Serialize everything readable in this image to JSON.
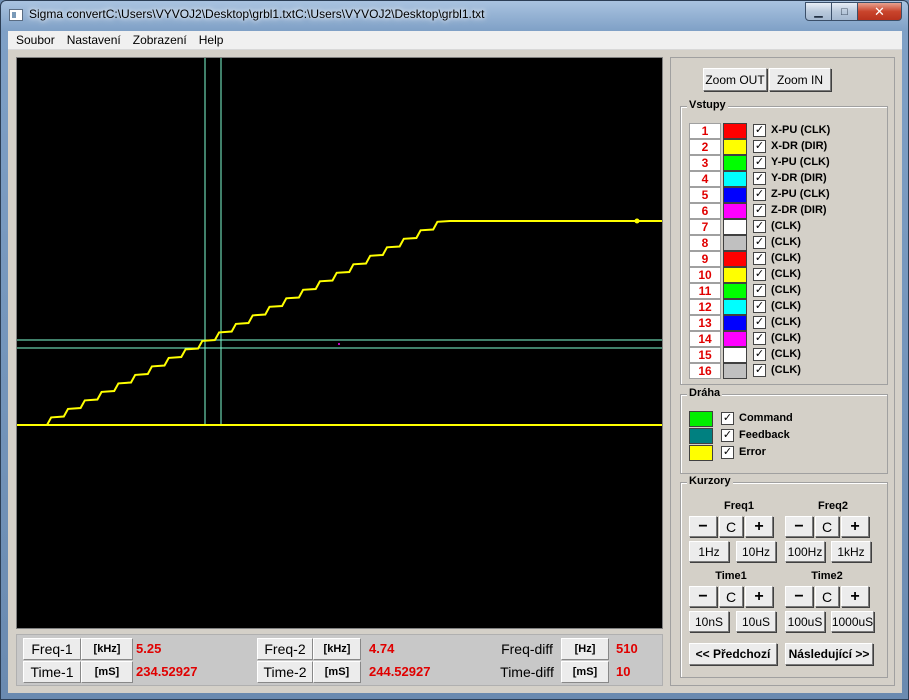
{
  "window": {
    "title": "Sigma convertC:\\Users\\VYVOJ2\\Desktop\\grbl1.txtC:\\Users\\VYVOJ2\\Desktop\\grbl1.txt",
    "min_glyph": "▁",
    "max_glyph": "□",
    "close_glyph": "✕"
  },
  "menu": [
    "Soubor",
    "Nastavení",
    "Zobrazení",
    "Help"
  ],
  "zoom": {
    "out_label": "Zoom OUT",
    "in_label": "Zoom IN"
  },
  "inputs": {
    "title": "Vstupy",
    "check_glyph": "✓",
    "items": [
      {
        "num": "1",
        "color": "#ff0000",
        "name": "X-PU (CLK)"
      },
      {
        "num": "2",
        "color": "#ffff00",
        "name": "X-DR (DIR)"
      },
      {
        "num": "3",
        "color": "#00ff00",
        "name": "Y-PU (CLK)"
      },
      {
        "num": "4",
        "color": "#00ffff",
        "name": "Y-DR (DIR)"
      },
      {
        "num": "5",
        "color": "#0000ff",
        "name": "Z-PU (CLK)"
      },
      {
        "num": "6",
        "color": "#ff00ff",
        "name": "Z-DR (DIR)"
      },
      {
        "num": "7",
        "color": "#ffffff",
        "name": "(CLK)"
      },
      {
        "num": "8",
        "color": "#c0c0c0",
        "name": "(CLK)"
      },
      {
        "num": "9",
        "color": "#ff0000",
        "name": "(CLK)"
      },
      {
        "num": "10",
        "color": "#ffff00",
        "name": "(CLK)"
      },
      {
        "num": "11",
        "color": "#00ff00",
        "name": "(CLK)"
      },
      {
        "num": "12",
        "color": "#00ffff",
        "name": "(CLK)"
      },
      {
        "num": "13",
        "color": "#0000ff",
        "name": "(CLK)"
      },
      {
        "num": "14",
        "color": "#ff00ff",
        "name": "(CLK)"
      },
      {
        "num": "15",
        "color": "#ffffff",
        "name": "(CLK)"
      },
      {
        "num": "16",
        "color": "#c0c0c0",
        "name": "(CLK)"
      }
    ]
  },
  "path": {
    "title": "Dráha",
    "items": [
      {
        "color": "#00ee00",
        "name": "Command"
      },
      {
        "color": "#008080",
        "name": "Feedback"
      },
      {
        "color": "#ffff00",
        "name": "Error"
      }
    ]
  },
  "cursors": {
    "title": "Kurzory",
    "freq1": {
      "title": "Freq1",
      "minus": "−",
      "c": "C",
      "plus": "+",
      "step_a": "1Hz",
      "step_b": "10Hz"
    },
    "freq2": {
      "title": "Freq2",
      "minus": "−",
      "c": "C",
      "plus": "+",
      "step_a": "100Hz",
      "step_b": "1kHz"
    },
    "time1": {
      "title": "Time1",
      "minus": "−",
      "c": "C",
      "plus": "+",
      "step_a": "10nS",
      "step_b": "10uS"
    },
    "time2": {
      "title": "Time2",
      "minus": "−",
      "c": "C",
      "plus": "+",
      "step_a": "100uS",
      "step_b": "1000uS"
    },
    "prev_label": "<< Předchozí",
    "next_label": "Následující >>"
  },
  "readout": {
    "freq1": {
      "label": "Freq-1",
      "unit": "[kHz]",
      "value": "5.25"
    },
    "freq2": {
      "label": "Freq-2",
      "unit": "[kHz]",
      "value": "4.74"
    },
    "freq_diff": {
      "label": "Freq-diff",
      "unit": "[Hz]",
      "value": "510"
    },
    "time1": {
      "label": "Time-1",
      "unit": "[mS]",
      "value": "234.52927"
    },
    "time2": {
      "label": "Time-2",
      "unit": "[mS]",
      "value": "244.52927"
    },
    "time_diff": {
      "label": "Time-diff",
      "unit": "[mS]",
      "value": "10"
    }
  },
  "scope": {
    "background": "#000000",
    "trace_color": "#ffff00",
    "cursor_color": "#7fffd4",
    "steps": 24
  }
}
